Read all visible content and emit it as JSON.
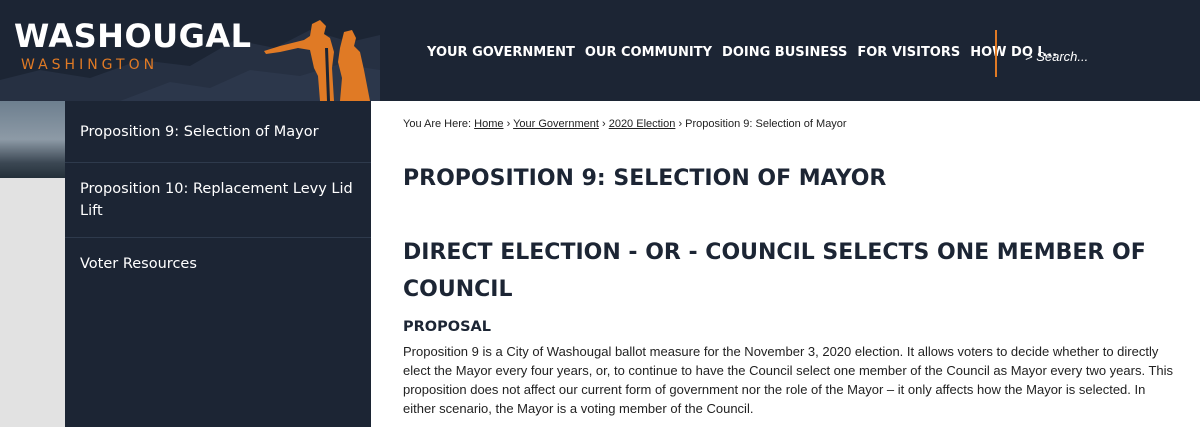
{
  "logo": {
    "title": "WASHOUGAL",
    "subtitle": "WASHINGTON"
  },
  "nav": [
    "YOUR GOVERNMENT",
    "OUR COMMUNITY",
    "DOING BUSINESS",
    "FOR VISITORS",
    "HOW DO I..."
  ],
  "search": {
    "placeholder": "> Search..."
  },
  "sidebar": {
    "items": [
      {
        "label": "Proposition 9: Selection of Mayor"
      },
      {
        "label": "Proposition 10: Replacement Levy Lid Lift"
      },
      {
        "label": "Voter Resources"
      }
    ]
  },
  "breadcrumb": {
    "prefix": "You Are Here:",
    "links": [
      "Home",
      "Your Government",
      "2020 Election"
    ],
    "current": "Proposition 9: Selection of Mayor",
    "separator": "›"
  },
  "main": {
    "title": "PROPOSITION 9: SELECTION OF MAYOR",
    "subtitle": "DIRECT ELECTION - OR - COUNCIL SELECTS ONE MEMBER OF COUNCIL",
    "section_heading": "PROPOSAL",
    "paragraph": "Proposition 9 is a City of Washougal ballot measure for the November 3, 2020 election. It allows voters to decide whether to directly elect the Mayor every four years, or, to continue to have the Council select one member of the Council as Mayor every two years. This proposition does not affect our current form of government nor the role of the Mayor – it only affects how the Mayor is selected. In either scenario, the Mayor is a voting member of the Council."
  },
  "colors": {
    "navy": "#1c2534",
    "accent": "#e07a25"
  }
}
